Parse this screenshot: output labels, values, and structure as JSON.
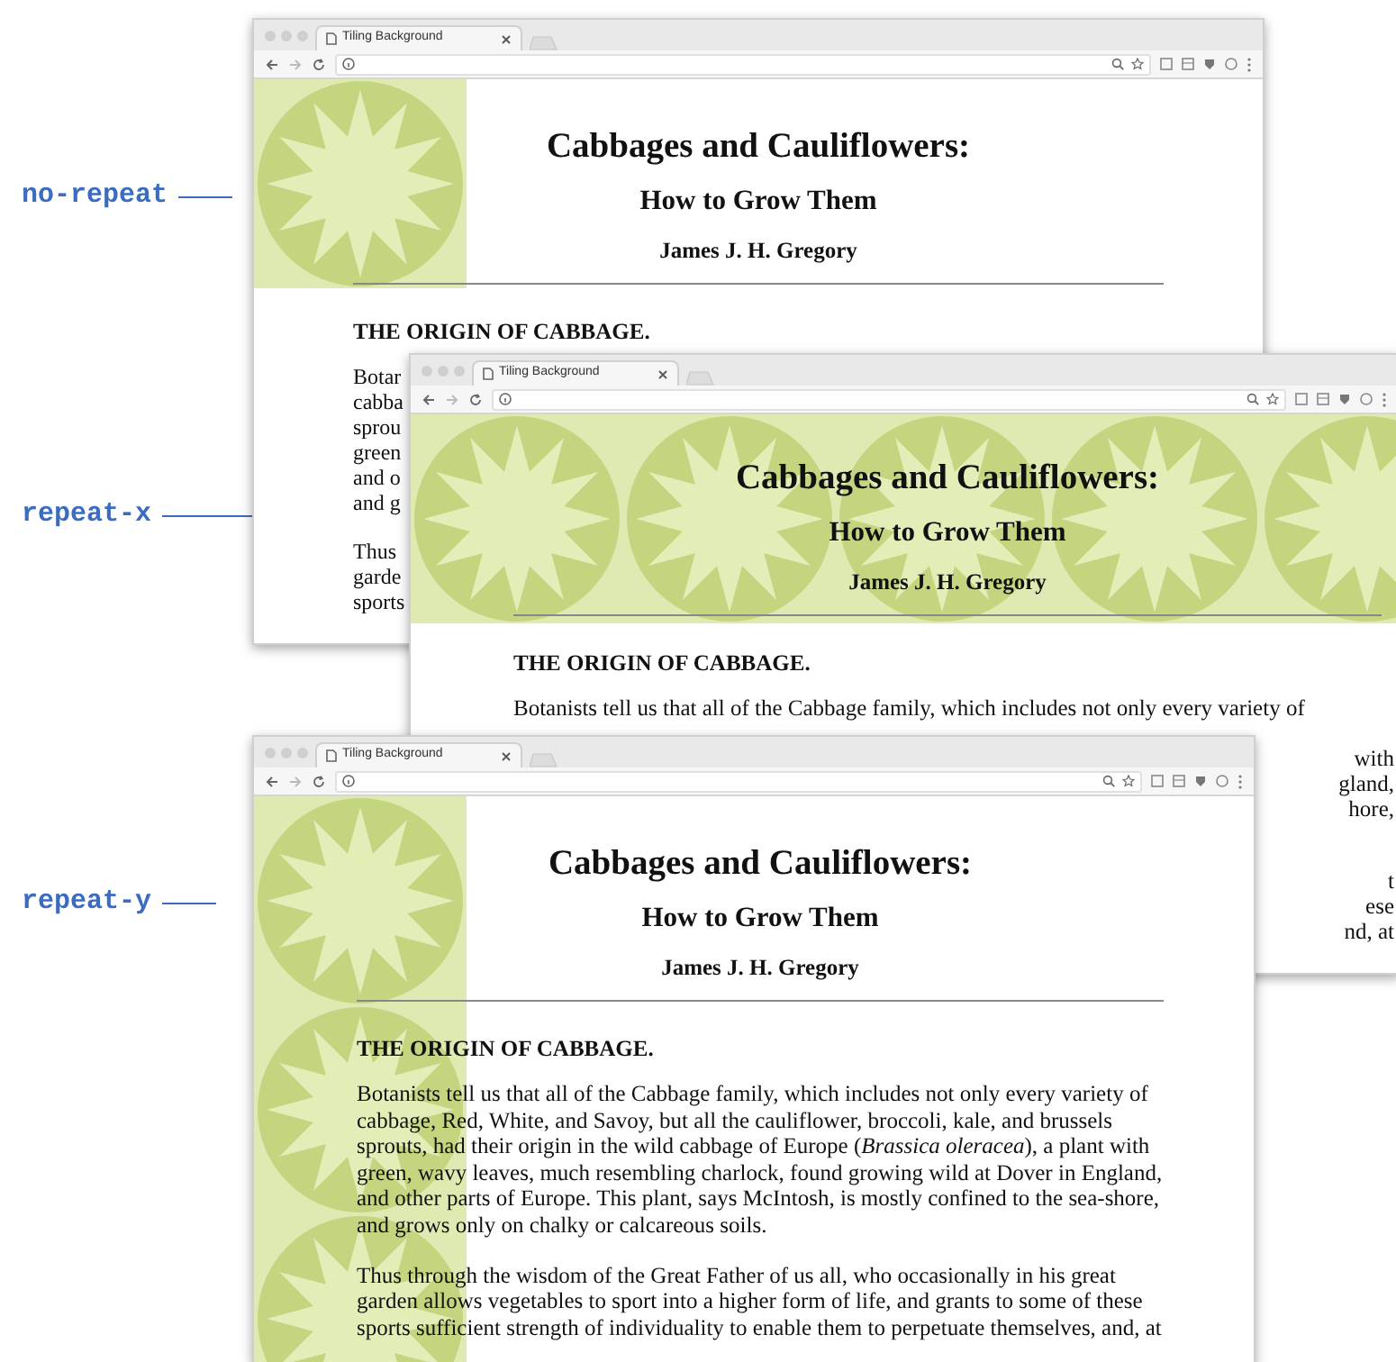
{
  "figure_labels": [
    {
      "text": "no-repeat"
    },
    {
      "text": "repeat-x"
    },
    {
      "text": "repeat-y"
    }
  ],
  "windows": [
    {
      "kind": "no-repeat",
      "tab_title": "Tiling Background",
      "title": "Cabbages and Cauliflowers:",
      "subtitle": "How to Grow Them",
      "author": "James J. H. Gregory",
      "section_heading": "THE ORIGIN OF CABBAGE.",
      "fragment_paragraphs": [
        {
          "lines": [
            {
              "kind": "left-fragment",
              "text": "Botar"
            },
            {
              "kind": "left-fragment",
              "text": "cabba"
            },
            {
              "kind": "left-fragment",
              "text": "sprou"
            },
            {
              "kind": "left-fragment",
              "text": "green"
            },
            {
              "kind": "left-fragment",
              "text": "and o"
            },
            {
              "kind": "left-fragment",
              "text": "and g"
            }
          ]
        },
        {
          "lines": [
            {
              "kind": "left-fragment",
              "text": "Thus"
            },
            {
              "kind": "left-fragment",
              "text": "garde"
            },
            {
              "kind": "left-fragment",
              "text": "sports"
            }
          ]
        }
      ]
    },
    {
      "kind": "repeat-x",
      "tab_title": "Tiling Background",
      "title": "Cabbages and Cauliflowers:",
      "subtitle": "How to Grow Them",
      "author": "James J. H. Gregory",
      "section_heading": "THE ORIGIN OF CABBAGE.",
      "fragment_paragraphs": [
        {
          "lines": [
            {
              "kind": "full",
              "text": "Botanists tell us that all of the Cabbage family, which includes not only every variety of"
            },
            {
              "kind": "right-fragment",
              "text": "with"
            },
            {
              "kind": "right-fragment",
              "text": "gland,"
            },
            {
              "kind": "right-fragment",
              "text": "hore,"
            }
          ]
        },
        {
          "lines": [
            {
              "kind": "right-fragment",
              "text": "t"
            },
            {
              "kind": "right-fragment",
              "text": "ese"
            },
            {
              "kind": "right-fragment",
              "text": "nd, at"
            }
          ]
        }
      ]
    },
    {
      "kind": "repeat-y",
      "tab_title": "Tiling Background",
      "title": "Cabbages and Cauliflowers:",
      "subtitle": "How to Grow Them",
      "author": "James J. H. Gregory",
      "section_heading": "THE ORIGIN OF CABBAGE.",
      "paragraphs": [
        "Botanists tell us that all of the Cabbage family, which includes not only every variety of cabbage, Red, White, and Savoy, but all the cauliflower, broccoli, kale, and brussels sprouts, had their origin in the wild cabbage of Europe (*Brassica oleracea*), a plant with green, wavy leaves, much resembling charlock, found growing wild at Dover in England, and other parts of Europe. This plant, says McIntosh, is mostly confined to the sea-shore, and grows only on chalky or calcareous soils.",
        "Thus through the wisdom of the Great Father of us all, who occasionally in his great garden allows vegetables to sport into a higher form of life, and grants to some of these sports sufficient strength of individuality to enable them to perpetuate themselves, and, at"
      ]
    }
  ]
}
